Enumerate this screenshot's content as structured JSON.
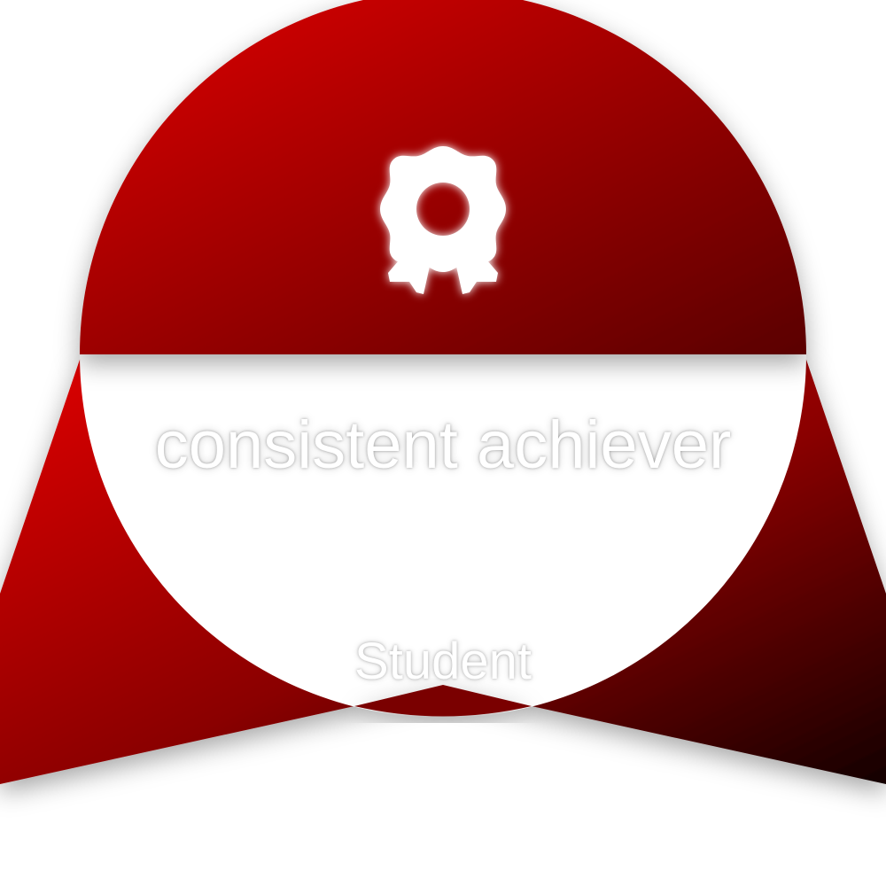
{
  "badge": {
    "title": "consistent achiever",
    "subtitle": "Student",
    "icon": "award-ribbon-icon",
    "colors": {
      "primary": "#d10000",
      "dark": "#5a0000",
      "deep": "#1a0000",
      "text": "#ffffff"
    }
  }
}
